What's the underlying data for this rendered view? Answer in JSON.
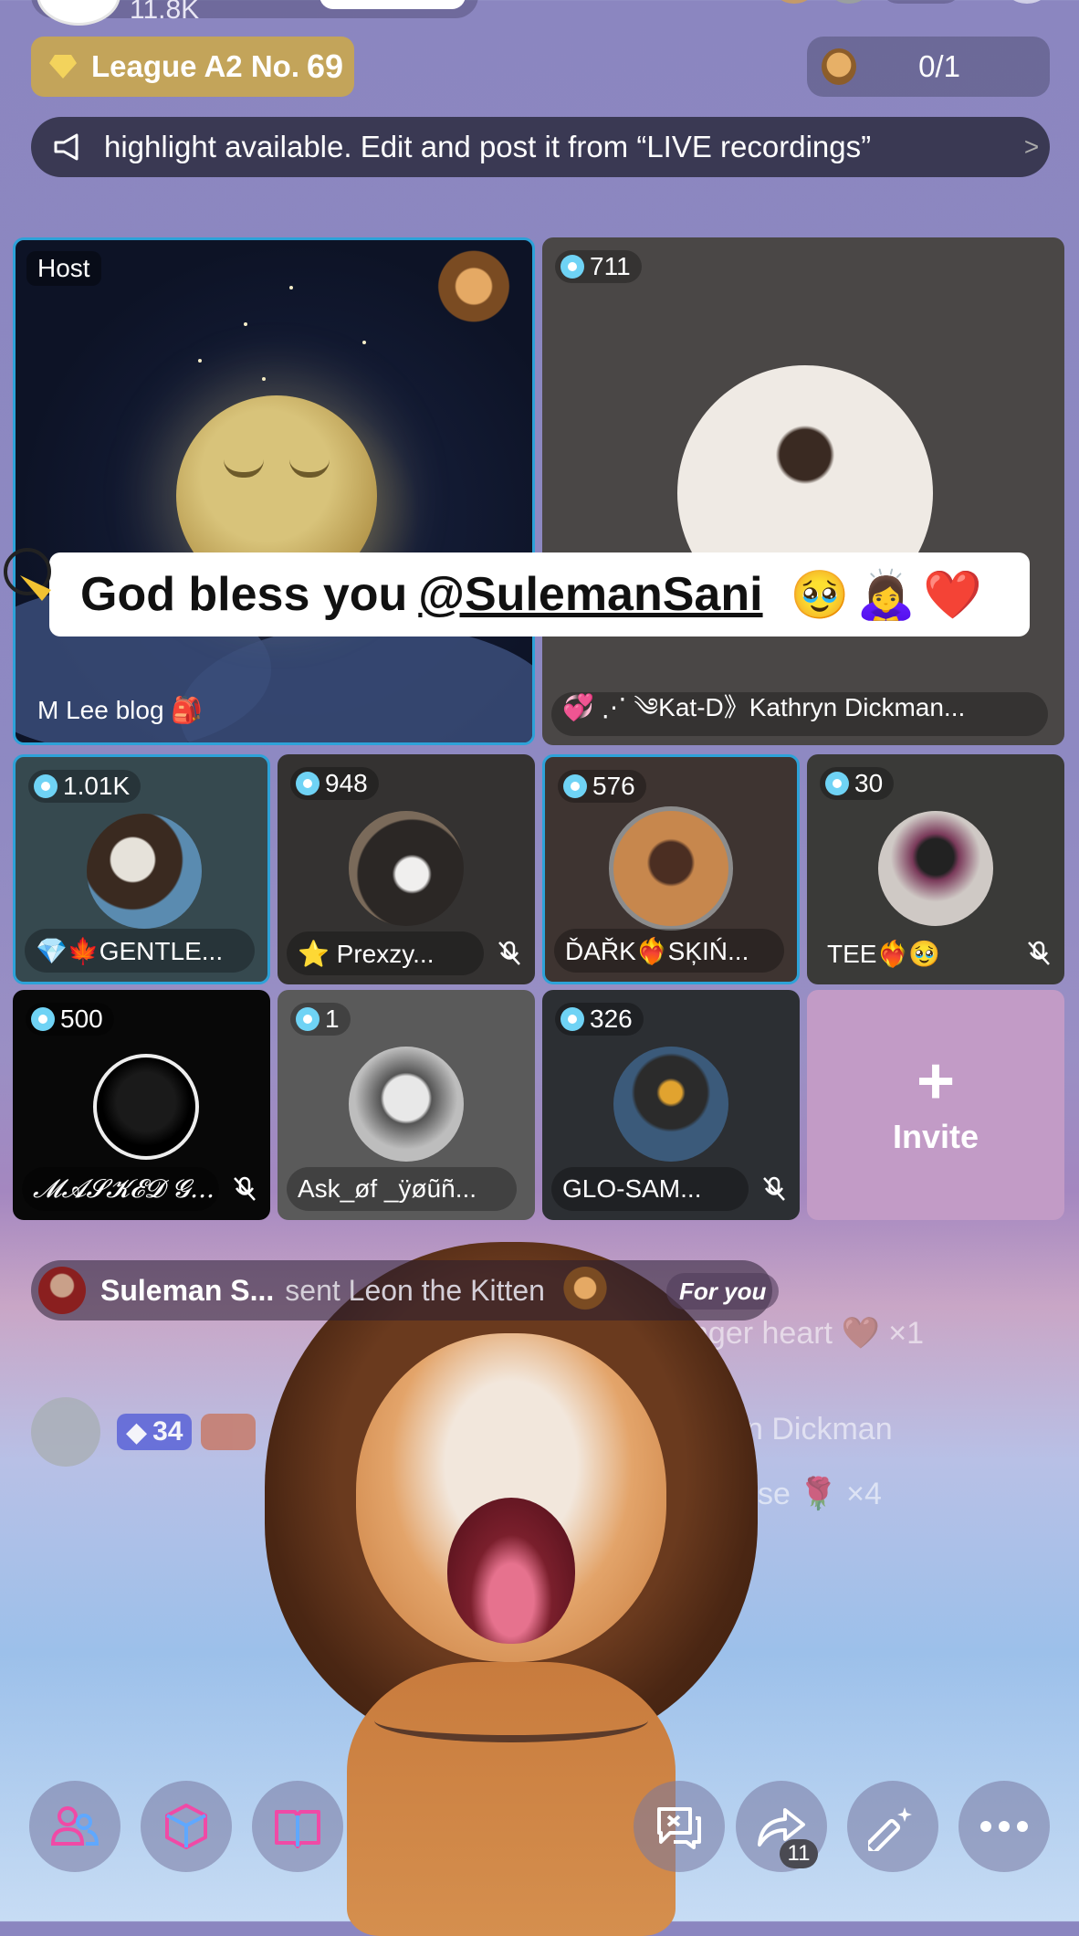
{
  "top": {
    "likes": "11.8K"
  },
  "league": {
    "label": "League A2 No.",
    "number": "69"
  },
  "goal": {
    "progress": "0/1"
  },
  "banner": {
    "text": "highlight available. Edit and post it from “LIVE recordings”",
    "chevron": ">"
  },
  "host": {
    "label": "Host",
    "name": "M Lee blog 🎒"
  },
  "comment": {
    "prefix": "God bless you",
    "mention": "@SulemanSani",
    "emojis": [
      "🥹",
      "🙇‍♀️",
      "❤️"
    ]
  },
  "guests": [
    {
      "count": "711",
      "name": "💞 ⋰ ༄Kat-D》Kathryn Dickman..."
    },
    {
      "count": "1.01K",
      "name": "💎🍁GENTLE..."
    },
    {
      "count": "948",
      "name": "⭐ Prexzy...",
      "muted": true
    },
    {
      "count": "576",
      "name": "ĎAŘK❤️‍🔥SĶIŃ..."
    },
    {
      "count": "30",
      "name": "TEE❤️‍🔥🥹",
      "muted": true
    },
    {
      "count": "500",
      "name": "𝓜𝓐𝓢𝓚𝓔𝓓 𝓖...",
      "muted": true
    },
    {
      "count": "1",
      "name": "Ask_øf _ÿøũñ..."
    },
    {
      "count": "326",
      "name": "GLO-SAM...",
      "muted": true
    }
  ],
  "invite": {
    "plus": "+",
    "label": "Invite"
  },
  "gift": {
    "sender": "Suleman S...",
    "text": "sent Leon the Kitten",
    "tag": "For you"
  },
  "feed": {
    "faint1": "finger heart 🤎 ×1",
    "level": "34",
    "faint2": "yn Dickman",
    "faint3": "se 🌹 ×4"
  },
  "toolbar": {
    "share_count": "11"
  },
  "icons": [
    "megaphone-icon",
    "diamond-icon",
    "mic-off-icon",
    "invite-plus-icon",
    "people-icon",
    "cube-icon",
    "book-icon",
    "chat-icon",
    "share-icon",
    "magic-wand-icon",
    "more-icon"
  ]
}
